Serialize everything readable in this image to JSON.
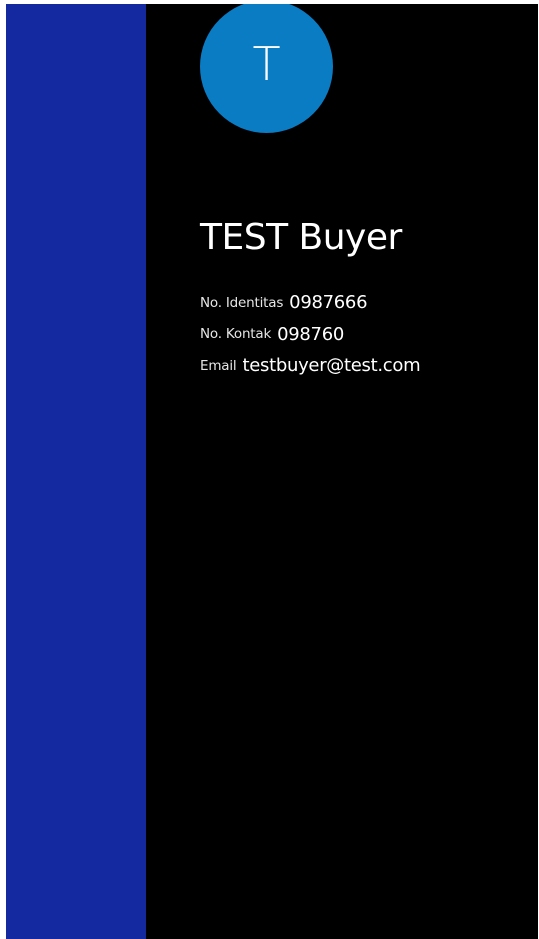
{
  "colors": {
    "sidebar": "#1428a0",
    "background": "#000000",
    "avatar": "#0a7cc4",
    "text": "#ffffff"
  },
  "profile": {
    "avatar_initial": "T",
    "name": "TEST Buyer",
    "fields": [
      {
        "label": "No. Identitas",
        "value": "0987666"
      },
      {
        "label": "No. Kontak",
        "value": "098760"
      },
      {
        "label": "Email",
        "value": "testbuyer@test.com"
      }
    ]
  }
}
